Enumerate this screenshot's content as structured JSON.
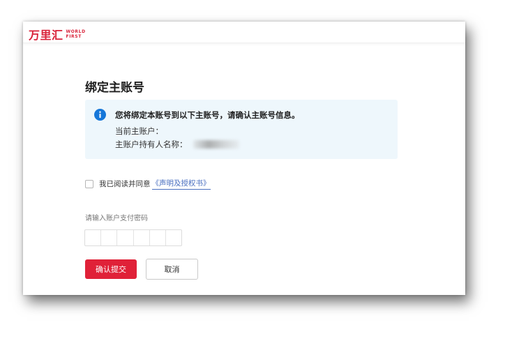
{
  "brand": {
    "logo_cn": "万里汇",
    "logo_en_line1": "WORLD",
    "logo_en_line2": "FIRST",
    "accent_color": "#d9233a"
  },
  "page": {
    "title": "绑定主账号"
  },
  "notice": {
    "icon": "info-icon",
    "message": "您将绑定本账号到以下主账号，请确认主账号信息。",
    "current_account_label": "当前主账户：",
    "holder_name_label": "主账户持有人名称："
  },
  "agreement": {
    "checked": false,
    "text": "我已阅读并同意",
    "link_text": "《声明及授权书》"
  },
  "password": {
    "label": "请输入账户支付密码",
    "digits": 6
  },
  "actions": {
    "confirm_label": "确认提交",
    "cancel_label": "取消"
  }
}
